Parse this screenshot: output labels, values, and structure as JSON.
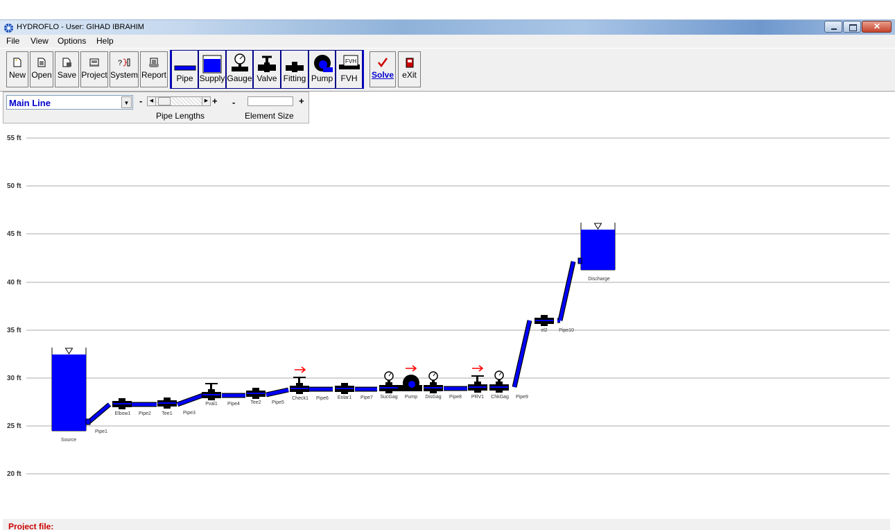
{
  "window": {
    "title": "HYDROFLO - User: GIHAD IBRAHIM"
  },
  "menu": {
    "items": [
      "File",
      "View",
      "Options",
      "Help"
    ]
  },
  "toolbar": {
    "buttons": [
      "New",
      "Open",
      "Save",
      "Project",
      "System",
      "Report"
    ],
    "elements": [
      "Pipe",
      "Supply",
      "Gauge",
      "Valve",
      "Fitting",
      "Pump",
      "FVH"
    ],
    "solve": "Solve",
    "exit": "eXit",
    "fvh_icon": "FVH"
  },
  "line_selector": {
    "value": "Main Line",
    "pipe_lengths_label": "Pipe Lengths",
    "element_size_label": "Element Size",
    "minus": "-",
    "plus": "+"
  },
  "elevation_grid": {
    "labels": [
      "55 ft",
      "50 ft",
      "45 ft",
      "40 ft",
      "35 ft",
      "30 ft",
      "25 ft",
      "20 ft"
    ]
  },
  "elements": [
    {
      "name": "Source",
      "type": "supply"
    },
    {
      "name": "Pipe1",
      "type": "pipe"
    },
    {
      "name": "Elbow1",
      "type": "fitting"
    },
    {
      "name": "Pipe2",
      "type": "pipe"
    },
    {
      "name": "Tee1",
      "type": "fitting"
    },
    {
      "name": "Pipe3",
      "type": "pipe"
    },
    {
      "name": "Pval1",
      "type": "valve"
    },
    {
      "name": "Pipe4",
      "type": "pipe"
    },
    {
      "name": "Tee2",
      "type": "fitting"
    },
    {
      "name": "Pipe5",
      "type": "pipe"
    },
    {
      "name": "Check1",
      "type": "valve"
    },
    {
      "name": "Pipe6",
      "type": "pipe"
    },
    {
      "name": "Enlar1",
      "type": "fitting"
    },
    {
      "name": "Pipe7",
      "type": "pipe"
    },
    {
      "name": "SucGag",
      "type": "gauge"
    },
    {
      "name": "Pump",
      "type": "pump"
    },
    {
      "name": "DisGag",
      "type": "gauge"
    },
    {
      "name": "Pipe8",
      "type": "pipe"
    },
    {
      "name": "PRV1",
      "type": "valve"
    },
    {
      "name": "ChkGag",
      "type": "gauge"
    },
    {
      "name": "Pipe9",
      "type": "pipe"
    },
    {
      "name": "el2",
      "type": "fitting"
    },
    {
      "name": "Pipe10",
      "type": "pipe"
    },
    {
      "name": "Discharge",
      "type": "supply"
    }
  ],
  "status": {
    "project_label": "Project file:"
  },
  "colors": {
    "element_blue": "#0000ff",
    "fitting_black": "#000000",
    "flow_arrow_red": "#ff0000",
    "group_border": "#0000cc",
    "grid_line": "#aaaaaa"
  }
}
